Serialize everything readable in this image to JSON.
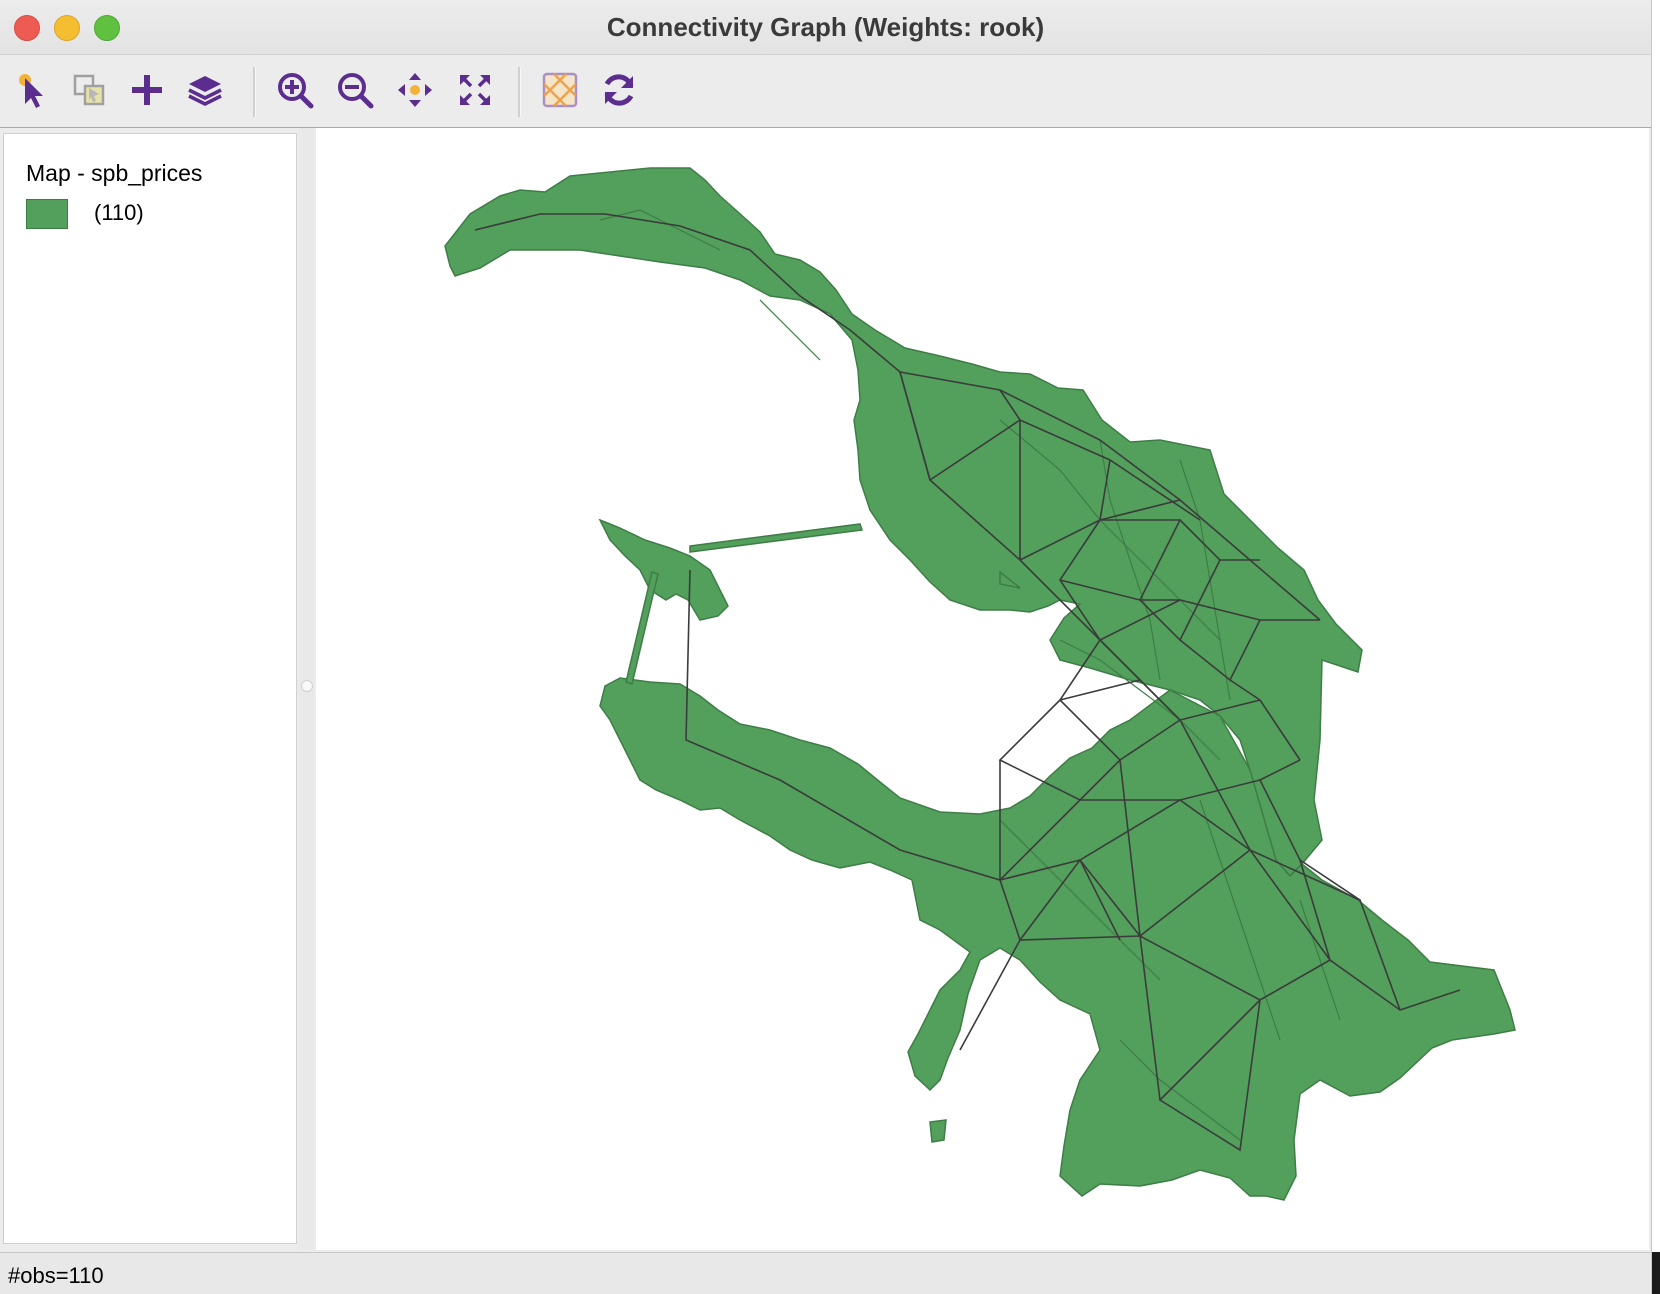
{
  "window": {
    "title": "Connectivity Graph (Weights: rook)"
  },
  "toolbar": {
    "tools": [
      {
        "name": "select-tool",
        "icon": "pointer-arrow-icon"
      },
      {
        "name": "selection-shape-tool",
        "icon": "selection-shape-icon"
      },
      {
        "name": "add-layer-tool",
        "icon": "plus-icon"
      },
      {
        "name": "layers-tool",
        "icon": "layers-icon"
      },
      {
        "name": "zoom-in-tool",
        "icon": "zoom-in-icon"
      },
      {
        "name": "zoom-out-icon",
        "icon": "zoom-out-icon"
      },
      {
        "name": "pan-tool",
        "icon": "pan-icon"
      },
      {
        "name": "full-extent-tool",
        "icon": "full-extent-icon"
      },
      {
        "name": "basemap-tool",
        "icon": "basemap-icon"
      },
      {
        "name": "refresh-tool",
        "icon": "refresh-icon"
      }
    ],
    "accent": "#5b2d8e"
  },
  "legend": {
    "title": "Map - spb_prices",
    "items": [
      {
        "label": "(110)",
        "color": "#52a05c"
      }
    ]
  },
  "map": {
    "fill_color": "#52a05c",
    "edge_color": "#3b3b3b"
  },
  "status": {
    "text": "#obs=110"
  }
}
